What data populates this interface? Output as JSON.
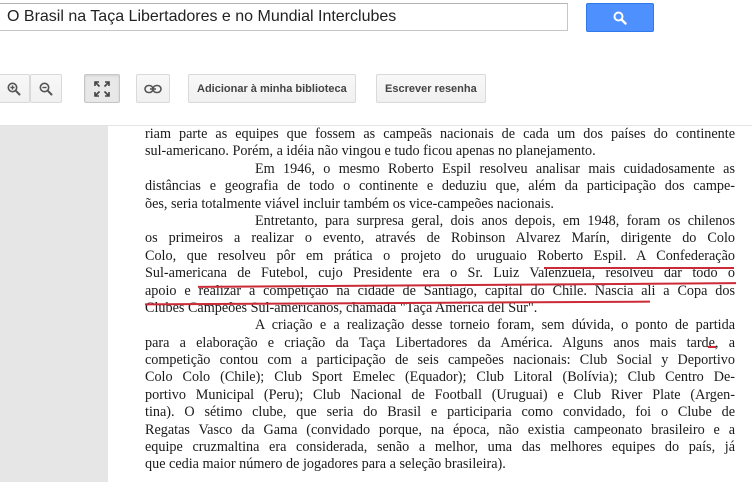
{
  "search": {
    "value": "O Brasil na Taça Libertadores e no Mundial Interclubes"
  },
  "toolbar": {
    "add_library_label": "Adicionar à minha biblioteca",
    "write_review_label": "Escrever resenha"
  },
  "colors": {
    "search_button": "#4d90fe",
    "underline": "#cc2a36",
    "gutter": "#e6e6e6"
  },
  "icons": {
    "search": "magnifier",
    "zoom_in": "zoom-in",
    "zoom_out": "zoom-out",
    "fullscreen": "expand",
    "link": "chain-link"
  },
  "page": {
    "lines": [
      "riam parte as equipes que fossem as campeãs nacionais de cada um dos países do continente",
      "sul-americano. Porém, a idéia não vingou e  tudo ficou apenas no planejamento.",
      "Em 1946, o mesmo Roberto Espil resolveu analisar mais cuidadosamente as",
      "distâncias e geografia de todo o continente e deduziu que, além da participação dos campe-",
      "ões, seria totalmente viável incluir também os vice-campeões nacionais.",
      "Entretanto, para surpresa geral, dois anos depois, em 1948, foram os chilenos",
      "os primeiros a realizar o evento, através de Robinson Alvarez Marín, dirigente do Colo",
      "Colo, que resolveu pôr em prática o projeto do uruguaio Roberto Espil. A Confederação",
      "Sul-americana de Futebol, cujo Presidente era o Sr. Luiz Valenzuela, resolveu dar todo o",
      "apoio e realizar a competição na cidade de Santiago, capital do Chile. Nascia ali a Copa dos",
      "Clubes Campeões Sul-americanos, chamada \"Taça América del Sur\".",
      "A criação e a realização desse torneio foram, sem dúvida, o ponto de partida",
      "para a elaboração e criação da Taça Libertadores da América. Alguns anos mais tarde, a",
      "competição contou com a participação de seis campeões nacionais: Club Social y Deportivo",
      "Colo Colo (Chile); Club Sport Emelec (Equador); Club Litoral (Bolívia); Club Centro De-",
      "portivo Municipal (Peru); Club Nacional de Football (Uruguai) e Club River Plate (Argen-",
      "tina). O sétimo clube, que seria do Brasil e participaria como convidado, foi o Clube de",
      "Regatas Vasco da Gama (convidado porque, na época, não existia campeonato brasileiro e a",
      "equipe cruzmaltina era considerada, senão a melhor, uma das melhores equipes do país, já",
      "que cedia maior número de jogadores para a seleção brasileira)."
    ]
  }
}
